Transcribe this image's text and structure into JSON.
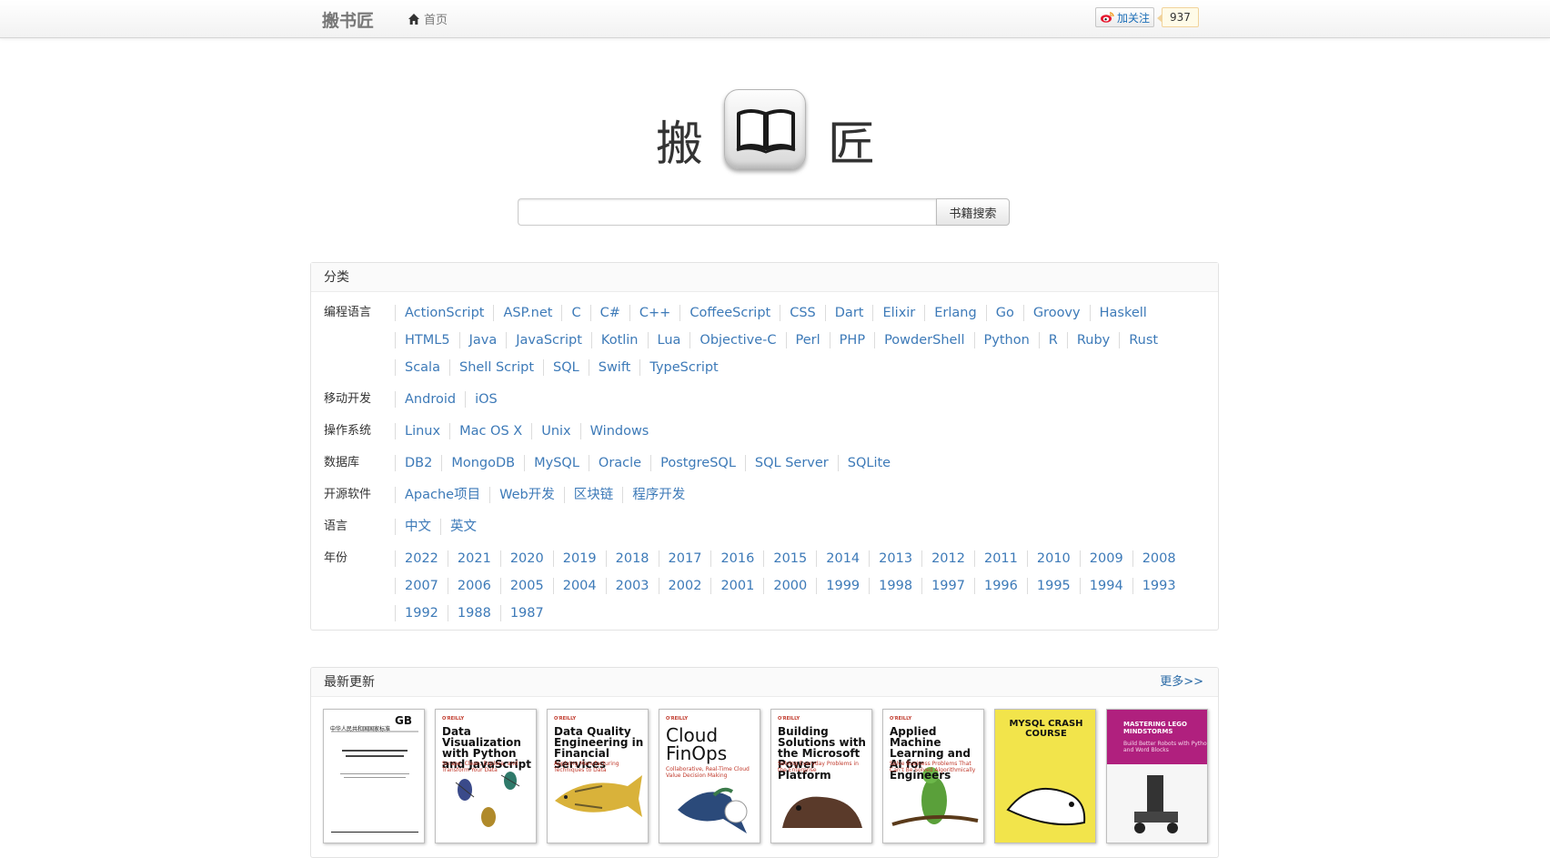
{
  "nav": {
    "brand": "搬书匠",
    "home_label": "首页",
    "follow_label": "加关注",
    "follow_count": "937"
  },
  "logo": {
    "char_left": "搬",
    "char_right": "匠"
  },
  "search": {
    "placeholder": "",
    "value": "",
    "button_label": "书籍搜索"
  },
  "categories": {
    "title": "分类",
    "groups": [
      {
        "label": "编程语言",
        "links": [
          "ActionScript",
          "ASP.net",
          "C",
          "C#",
          "C++",
          "CoffeeScript",
          "CSS",
          "Dart",
          "Elixir",
          "Erlang",
          "Go",
          "Groovy",
          "Haskell",
          "HTML5",
          "Java",
          "JavaScript",
          "Kotlin",
          "Lua",
          "Objective-C",
          "Perl",
          "PHP",
          "PowderShell",
          "Python",
          "R",
          "Ruby",
          "Rust",
          "Scala",
          "Shell Script",
          "SQL",
          "Swift",
          "TypeScript"
        ]
      },
      {
        "label": "移动开发",
        "links": [
          "Android",
          "iOS"
        ]
      },
      {
        "label": "操作系统",
        "links": [
          "Linux",
          "Mac OS X",
          "Unix",
          "Windows"
        ]
      },
      {
        "label": "数据库",
        "links": [
          "DB2",
          "MongoDB",
          "MySQL",
          "Oracle",
          "PostgreSQL",
          "SQL Server",
          "SQLite"
        ]
      },
      {
        "label": "开源软件",
        "links": [
          "Apache项目",
          "Web开发",
          "区块链",
          "程序开发"
        ]
      },
      {
        "label": "语言",
        "links": [
          "中文",
          "英文"
        ]
      },
      {
        "label": "年份",
        "links": [
          "2022",
          "2021",
          "2020",
          "2019",
          "2018",
          "2017",
          "2016",
          "2015",
          "2014",
          "2013",
          "2012",
          "2011",
          "2010",
          "2009",
          "2008",
          "2007",
          "2006",
          "2005",
          "2004",
          "2003",
          "2002",
          "2001",
          "2000",
          "1999",
          "1998",
          "1997",
          "1996",
          "1995",
          "1994",
          "1993",
          "1992",
          "1988",
          "1987"
        ]
      }
    ]
  },
  "latest": {
    "title": "最新更新",
    "more_label": "更多>>",
    "books": [
      {
        "title": "GB",
        "sub": "中华人民共和国国家标准",
        "publisher": "",
        "accent": "#ffffff"
      },
      {
        "title": "Data Visualization with Python and JavaScript",
        "sub": "Scrape, Clean, Explore, and Transform Your Data",
        "publisher": "O'REILLY",
        "accent": "#ffffff"
      },
      {
        "title": "Data Quality Engineering in Financial Services",
        "sub": "Applying Manufacturing Techniques to Data",
        "publisher": "O'REILLY",
        "accent": "#ffffff"
      },
      {
        "title": "Cloud FinOps",
        "sub": "Collaborative, Real-Time Cloud Value Decision Making",
        "publisher": "O'REILLY",
        "accent": "#ffffff"
      },
      {
        "title": "Building Solutions with the Microsoft Power Platform",
        "sub": "Solving Everyday Problems in the Enterprise",
        "publisher": "O'REILLY",
        "accent": "#ffffff"
      },
      {
        "title": "Applied Machine Learning and AI for Engineers",
        "sub": "Solve Business Problems That Can't Be Solved Algorithmically",
        "publisher": "O'REILLY",
        "accent": "#ffffff"
      },
      {
        "title": "MYSQL CRASH COURSE",
        "sub": "",
        "publisher": "",
        "accent": "#f2e44b"
      },
      {
        "title": "MASTERING LEGO MINDSTORMS",
        "sub": "Build Better Robots with Python and Word Blocks",
        "publisher": "",
        "accent": "#b0207e"
      }
    ]
  }
}
